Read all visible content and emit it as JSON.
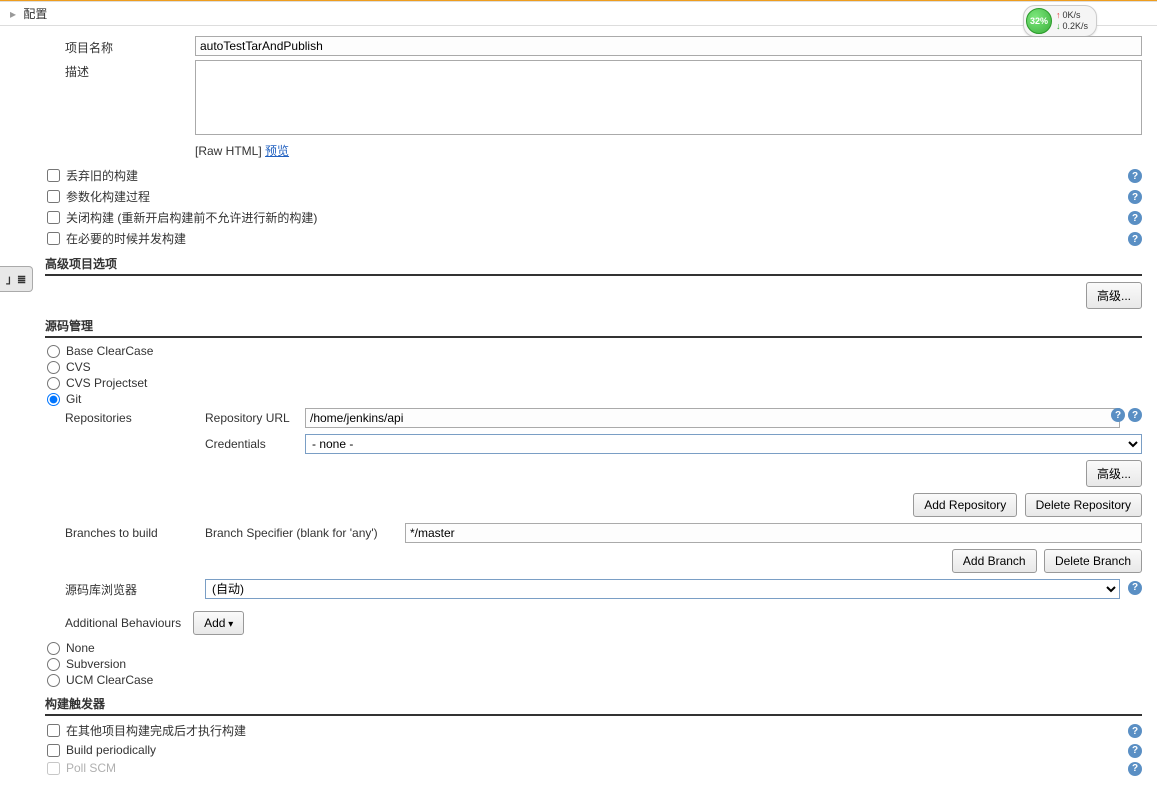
{
  "breadcrumb": {
    "title": "配置"
  },
  "network": {
    "percent": "32%",
    "up": "0K/s",
    "down": "0.2K/s"
  },
  "sideTab": "」≣",
  "form": {
    "projectNameLabel": "项目名称",
    "projectNameValue": "autoTestTarAndPublish",
    "descriptionLabel": "描述",
    "descriptionValue": "",
    "rawHtmlPrefix": "[Raw HTML]",
    "previewLink": "预览"
  },
  "checkboxes": {
    "discard": "丢弃旧的构建",
    "parameterized": "参数化构建过程",
    "disable": "关闭构建 (重新开启构建前不允许进行新的构建)",
    "concurrent": "在必要的时候并发构建"
  },
  "sections": {
    "advancedProject": "高级项目选项",
    "scm": "源码管理",
    "triggers": "构建触发器"
  },
  "buttons": {
    "advanced": "高级...",
    "addRepository": "Add Repository",
    "deleteRepository": "Delete Repository",
    "addBranch": "Add Branch",
    "deleteBranch": "Delete Branch",
    "add": "Add"
  },
  "scm": {
    "options": {
      "baseClearCase": "Base ClearCase",
      "cvs": "CVS",
      "cvsProjectset": "CVS Projectset",
      "git": "Git",
      "none": "None",
      "subversion": "Subversion",
      "ucmClearCase": "UCM ClearCase"
    },
    "git": {
      "repositoriesLabel": "Repositories",
      "repoUrlLabel": "Repository URL",
      "repoUrlValue": "/home/jenkins/api",
      "credentialsLabel": "Credentials",
      "credentialsValue": "- none -",
      "branchesLabel": "Branches to build",
      "branchSpecifierLabel": "Branch Specifier (blank for 'any')",
      "branchSpecifierValue": "*/master",
      "browserLabel": "源码库浏览器",
      "browserValue": "(自动)",
      "additionalBehavioursLabel": "Additional Behaviours"
    }
  },
  "triggers": {
    "buildAfter": "在其他项目构建完成后才执行构建",
    "periodically": "Build periodically",
    "pollScm": "Poll SCM"
  }
}
